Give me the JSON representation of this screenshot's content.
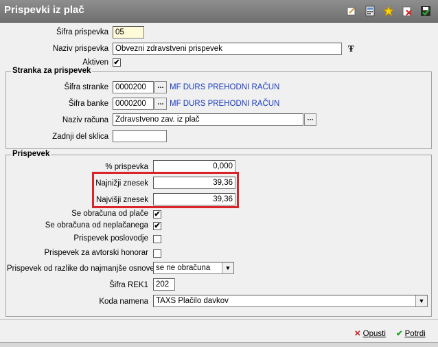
{
  "window": {
    "title": "Prispevki iz plač",
    "toolbar_icons": [
      "edit-icon",
      "calculator-icon",
      "star-icon",
      "delete-icon",
      "save-icon"
    ]
  },
  "main": {
    "sifra_label": "Šifra prispevka",
    "sifra_value": "05",
    "naziv_label": "Naziv prispevka",
    "naziv_value": "Obvezni zdravstveni prispevek",
    "aktiven_label": "Aktiven",
    "aktiven_checked": true
  },
  "stranka": {
    "group_title": "Stranka za prispevek",
    "sifra_stranke_label": "Šifra stranke",
    "sifra_stranke_value": "0000200",
    "sifra_stranke_name": "MF DURS PREHODNI RAČUN",
    "sifra_banke_label": "Šifra banke",
    "sifra_banke_value": "0000200",
    "sifra_banke_name": "MF DURS PREHODNI RAČUN",
    "naziv_racuna_label": "Naziv računa",
    "naziv_racuna_value": "Zdravstveno zav. iz plač",
    "zadnji_del_label": "Zadnji del sklica",
    "zadnji_del_value": "",
    "dots": "..."
  },
  "prispevek": {
    "group_title": "Prispevek",
    "pct_label": "% prispevka",
    "pct_value": "0,000",
    "najnizji_label": "Najnižji znesek",
    "najnizji_value": "39,36",
    "najvisji_label": "Najvišji znesek",
    "najvisji_value": "39,36",
    "se_obracuna_label": "Se obračuna od plače",
    "se_obracuna_checked": true,
    "neplacanega_label": "Se obračuna od neplačanega",
    "neplacanega_checked": true,
    "poslovodje_label": "Prispevek poslovodje",
    "poslovodje_checked": false,
    "avtorski_label": "Prispevek za avtorski honorar",
    "avtorski_checked": false,
    "razlika_label": "Prispevek od razlike do najmanjše osnove",
    "razlika_value": "se ne obračuna",
    "rek1_label": "Šifra REK1",
    "rek1_value": "202",
    "koda_label": "Koda namena",
    "koda_value": "TAXS Plačilo davkov"
  },
  "footer": {
    "cancel_label": "Opusti",
    "confirm_label": "Potrdi"
  },
  "colors": {
    "titlebar": "#7f7f7f",
    "highlight": "#d9252a",
    "link": "#1a3cbe",
    "key_field": "#fffbd8"
  }
}
